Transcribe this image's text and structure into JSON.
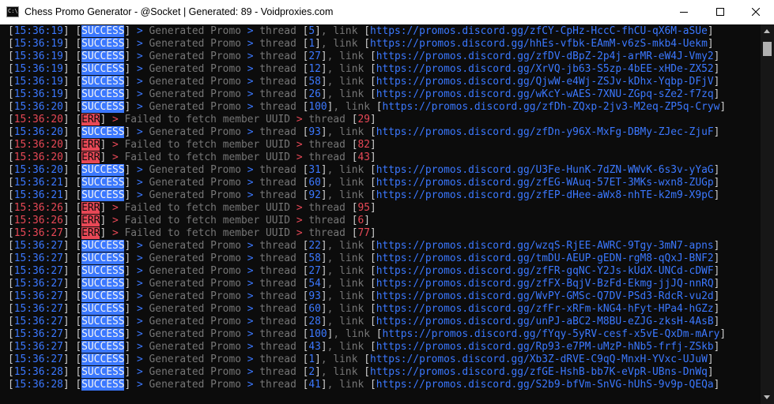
{
  "window": {
    "title": "Chess Promo Generator - @Socket | Generated: 89 - Voidproxies.com",
    "icon_text": "C:\\."
  },
  "log": [
    {
      "ts": "15:36:19",
      "kind": "success",
      "tag": "SUCCESS",
      "message": "Generated Promo",
      "thread": "5",
      "link": "https://promos.discord.gg/zfCY-CpHz-HccC-fhCU-qX6M-aSUe"
    },
    {
      "ts": "15:36:19",
      "kind": "success",
      "tag": "SUCCESS",
      "message": "Generated Promo",
      "thread": "1",
      "link": "https://promos.discord.gg/hhEs-vfbk-EAmM-v6zS-mkb4-Uekm"
    },
    {
      "ts": "15:36:19",
      "kind": "success",
      "tag": "SUCCESS",
      "message": "Generated Promo",
      "thread": "27",
      "link": "https://promos.discord.gg/zfDV-dBpZ-2p4j-arMR-eW4J-Vmy2"
    },
    {
      "ts": "15:36:19",
      "kind": "success",
      "tag": "SUCCESS",
      "message": "Generated Promo",
      "thread": "12",
      "link": "https://promos.discord.gg/XrVQ-jb63-S5zp-4bEE-xHDe-ZX52"
    },
    {
      "ts": "15:36:19",
      "kind": "success",
      "tag": "SUCCESS",
      "message": "Generated Promo",
      "thread": "58",
      "link": "https://promos.discord.gg/QjwW-e4Wj-ZSJv-kDhx-Yqbp-DFjV"
    },
    {
      "ts": "15:36:19",
      "kind": "success",
      "tag": "SUCCESS",
      "message": "Generated Promo",
      "thread": "26",
      "link": "https://promos.discord.gg/wKcY-wAES-7XNU-ZGpq-sZe2-f7zq"
    },
    {
      "ts": "15:36:20",
      "kind": "success",
      "tag": "SUCCESS",
      "message": "Generated Promo",
      "thread": "100",
      "link": "https://promos.discord.gg/zfDh-ZQxp-2jv3-M2eq-ZP5q-Cryw"
    },
    {
      "ts": "15:36:20",
      "kind": "error",
      "tag": "ERR",
      "message": "Failed to fetch member UUID",
      "thread": "29"
    },
    {
      "ts": "15:36:20",
      "kind": "success",
      "tag": "SUCCESS",
      "message": "Generated Promo",
      "thread": "93",
      "link": "https://promos.discord.gg/zfDn-y96X-MxFg-DBMy-ZJec-ZjuF"
    },
    {
      "ts": "15:36:20",
      "kind": "error",
      "tag": "ERR",
      "message": "Failed to fetch member UUID",
      "thread": "82"
    },
    {
      "ts": "15:36:20",
      "kind": "error",
      "tag": "ERR",
      "message": "Failed to fetch member UUID",
      "thread": "43"
    },
    {
      "ts": "15:36:20",
      "kind": "success",
      "tag": "SUCCESS",
      "message": "Generated Promo",
      "thread": "31",
      "link": "https://promos.discord.gg/U3Fe-HunK-7dZN-WWvK-6s3v-yYaG"
    },
    {
      "ts": "15:36:21",
      "kind": "success",
      "tag": "SUCCESS",
      "message": "Generated Promo",
      "thread": "60",
      "link": "https://promos.discord.gg/zfEG-WAuq-57ET-3MKs-wxn8-ZUGp"
    },
    {
      "ts": "15:36:21",
      "kind": "success",
      "tag": "SUCCESS",
      "message": "Generated Promo",
      "thread": "92",
      "link": "https://promos.discord.gg/zfEP-dHee-aWx8-nhTE-k2m9-X9pC"
    },
    {
      "ts": "15:36:26",
      "kind": "error",
      "tag": "ERR",
      "message": "Failed to fetch member UUID",
      "thread": "95"
    },
    {
      "ts": "15:36:26",
      "kind": "error",
      "tag": "ERR",
      "message": "Failed to fetch member UUID",
      "thread": "6"
    },
    {
      "ts": "15:36:27",
      "kind": "error",
      "tag": "ERR",
      "message": "Failed to fetch member UUID",
      "thread": "77"
    },
    {
      "ts": "15:36:27",
      "kind": "success",
      "tag": "SUCCESS",
      "message": "Generated Promo",
      "thread": "22",
      "link": "https://promos.discord.gg/wzqS-RjEE-AWRC-9Tgy-3mN7-apns"
    },
    {
      "ts": "15:36:27",
      "kind": "success",
      "tag": "SUCCESS",
      "message": "Generated Promo",
      "thread": "58",
      "link": "https://promos.discord.gg/tmDU-AEUP-gEDN-rgM8-qQxJ-BNF2"
    },
    {
      "ts": "15:36:27",
      "kind": "success",
      "tag": "SUCCESS",
      "message": "Generated Promo",
      "thread": "27",
      "link": "https://promos.discord.gg/zfFR-gqNC-Y2Js-kUdX-UNCd-cDWF"
    },
    {
      "ts": "15:36:27",
      "kind": "success",
      "tag": "SUCCESS",
      "message": "Generated Promo",
      "thread": "54",
      "link": "https://promos.discord.gg/zfFX-BqjV-BzFd-Ekmg-jjJQ-nnRQ"
    },
    {
      "ts": "15:36:27",
      "kind": "success",
      "tag": "SUCCESS",
      "message": "Generated Promo",
      "thread": "93",
      "link": "https://promos.discord.gg/WvPY-GMSc-Q7DV-PSd3-RdcR-vu2d"
    },
    {
      "ts": "15:36:27",
      "kind": "success",
      "tag": "SUCCESS",
      "message": "Generated Promo",
      "thread": "60",
      "link": "https://promos.discord.gg/zfFr-xRFm-kNG4-hFyt-HPa4-hGZz"
    },
    {
      "ts": "15:36:27",
      "kind": "success",
      "tag": "SUCCESS",
      "message": "Generated Promo",
      "thread": "28",
      "link": "https://promos.discord.gg/unPJ-aBC2-M8BU-eZJG-zksH-4AsB"
    },
    {
      "ts": "15:36:27",
      "kind": "success",
      "tag": "SUCCESS",
      "message": "Generated Promo",
      "thread": "100",
      "link": "https://promos.discord.gg/fYqy-5yRV-cesf-x5vE-QxDm-mAry"
    },
    {
      "ts": "15:36:27",
      "kind": "success",
      "tag": "SUCCESS",
      "message": "Generated Promo",
      "thread": "43",
      "link": "https://promos.discord.gg/Rp93-e7PM-uMzP-hNb5-frfj-ZSkb"
    },
    {
      "ts": "15:36:27",
      "kind": "success",
      "tag": "SUCCESS",
      "message": "Generated Promo",
      "thread": "1",
      "link": "https://promos.discord.gg/Xb3Z-dRVE-C9qQ-MnxH-YVxc-UJuW"
    },
    {
      "ts": "15:36:28",
      "kind": "success",
      "tag": "SUCCESS",
      "message": "Generated Promo",
      "thread": "2",
      "link": "https://promos.discord.gg/zfGE-HshB-bb7K-eVpR-UBns-DnWq"
    },
    {
      "ts": "15:36:28",
      "kind": "success",
      "tag": "SUCCESS",
      "message": "Generated Promo",
      "thread": "41",
      "link": "https://promos.discord.gg/S2b9-bfVm-SnVG-hUhS-9v9p-QEQa"
    }
  ],
  "colors": {
    "background": "#0c0c0c",
    "success": "#3b78ff",
    "error": "#e74856",
    "text_dim": "#767676",
    "bracket": "#cccccc"
  },
  "icons": [
    "console-app-icon",
    "minimize-icon",
    "maximize-icon",
    "close-icon"
  ]
}
